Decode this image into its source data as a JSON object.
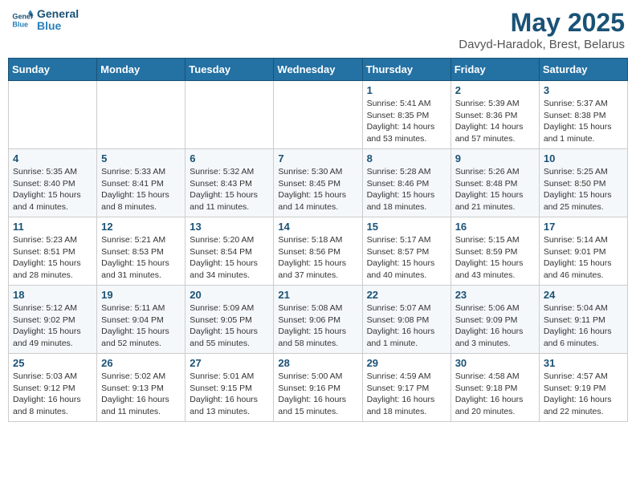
{
  "logo": {
    "line1": "General",
    "line2": "Blue"
  },
  "title": "May 2025",
  "location": "Davyd-Haradok, Brest, Belarus",
  "weekdays": [
    "Sunday",
    "Monday",
    "Tuesday",
    "Wednesday",
    "Thursday",
    "Friday",
    "Saturday"
  ],
  "weeks": [
    [
      {
        "day": "",
        "info": ""
      },
      {
        "day": "",
        "info": ""
      },
      {
        "day": "",
        "info": ""
      },
      {
        "day": "",
        "info": ""
      },
      {
        "day": "1",
        "info": "Sunrise: 5:41 AM\nSunset: 8:35 PM\nDaylight: 14 hours\nand 53 minutes."
      },
      {
        "day": "2",
        "info": "Sunrise: 5:39 AM\nSunset: 8:36 PM\nDaylight: 14 hours\nand 57 minutes."
      },
      {
        "day": "3",
        "info": "Sunrise: 5:37 AM\nSunset: 8:38 PM\nDaylight: 15 hours\nand 1 minute."
      }
    ],
    [
      {
        "day": "4",
        "info": "Sunrise: 5:35 AM\nSunset: 8:40 PM\nDaylight: 15 hours\nand 4 minutes."
      },
      {
        "day": "5",
        "info": "Sunrise: 5:33 AM\nSunset: 8:41 PM\nDaylight: 15 hours\nand 8 minutes."
      },
      {
        "day": "6",
        "info": "Sunrise: 5:32 AM\nSunset: 8:43 PM\nDaylight: 15 hours\nand 11 minutes."
      },
      {
        "day": "7",
        "info": "Sunrise: 5:30 AM\nSunset: 8:45 PM\nDaylight: 15 hours\nand 14 minutes."
      },
      {
        "day": "8",
        "info": "Sunrise: 5:28 AM\nSunset: 8:46 PM\nDaylight: 15 hours\nand 18 minutes."
      },
      {
        "day": "9",
        "info": "Sunrise: 5:26 AM\nSunset: 8:48 PM\nDaylight: 15 hours\nand 21 minutes."
      },
      {
        "day": "10",
        "info": "Sunrise: 5:25 AM\nSunset: 8:50 PM\nDaylight: 15 hours\nand 25 minutes."
      }
    ],
    [
      {
        "day": "11",
        "info": "Sunrise: 5:23 AM\nSunset: 8:51 PM\nDaylight: 15 hours\nand 28 minutes."
      },
      {
        "day": "12",
        "info": "Sunrise: 5:21 AM\nSunset: 8:53 PM\nDaylight: 15 hours\nand 31 minutes."
      },
      {
        "day": "13",
        "info": "Sunrise: 5:20 AM\nSunset: 8:54 PM\nDaylight: 15 hours\nand 34 minutes."
      },
      {
        "day": "14",
        "info": "Sunrise: 5:18 AM\nSunset: 8:56 PM\nDaylight: 15 hours\nand 37 minutes."
      },
      {
        "day": "15",
        "info": "Sunrise: 5:17 AM\nSunset: 8:57 PM\nDaylight: 15 hours\nand 40 minutes."
      },
      {
        "day": "16",
        "info": "Sunrise: 5:15 AM\nSunset: 8:59 PM\nDaylight: 15 hours\nand 43 minutes."
      },
      {
        "day": "17",
        "info": "Sunrise: 5:14 AM\nSunset: 9:01 PM\nDaylight: 15 hours\nand 46 minutes."
      }
    ],
    [
      {
        "day": "18",
        "info": "Sunrise: 5:12 AM\nSunset: 9:02 PM\nDaylight: 15 hours\nand 49 minutes."
      },
      {
        "day": "19",
        "info": "Sunrise: 5:11 AM\nSunset: 9:04 PM\nDaylight: 15 hours\nand 52 minutes."
      },
      {
        "day": "20",
        "info": "Sunrise: 5:09 AM\nSunset: 9:05 PM\nDaylight: 15 hours\nand 55 minutes."
      },
      {
        "day": "21",
        "info": "Sunrise: 5:08 AM\nSunset: 9:06 PM\nDaylight: 15 hours\nand 58 minutes."
      },
      {
        "day": "22",
        "info": "Sunrise: 5:07 AM\nSunset: 9:08 PM\nDaylight: 16 hours\nand 1 minute."
      },
      {
        "day": "23",
        "info": "Sunrise: 5:06 AM\nSunset: 9:09 PM\nDaylight: 16 hours\nand 3 minutes."
      },
      {
        "day": "24",
        "info": "Sunrise: 5:04 AM\nSunset: 9:11 PM\nDaylight: 16 hours\nand 6 minutes."
      }
    ],
    [
      {
        "day": "25",
        "info": "Sunrise: 5:03 AM\nSunset: 9:12 PM\nDaylight: 16 hours\nand 8 minutes."
      },
      {
        "day": "26",
        "info": "Sunrise: 5:02 AM\nSunset: 9:13 PM\nDaylight: 16 hours\nand 11 minutes."
      },
      {
        "day": "27",
        "info": "Sunrise: 5:01 AM\nSunset: 9:15 PM\nDaylight: 16 hours\nand 13 minutes."
      },
      {
        "day": "28",
        "info": "Sunrise: 5:00 AM\nSunset: 9:16 PM\nDaylight: 16 hours\nand 15 minutes."
      },
      {
        "day": "29",
        "info": "Sunrise: 4:59 AM\nSunset: 9:17 PM\nDaylight: 16 hours\nand 18 minutes."
      },
      {
        "day": "30",
        "info": "Sunrise: 4:58 AM\nSunset: 9:18 PM\nDaylight: 16 hours\nand 20 minutes."
      },
      {
        "day": "31",
        "info": "Sunrise: 4:57 AM\nSunset: 9:19 PM\nDaylight: 16 hours\nand 22 minutes."
      }
    ]
  ]
}
